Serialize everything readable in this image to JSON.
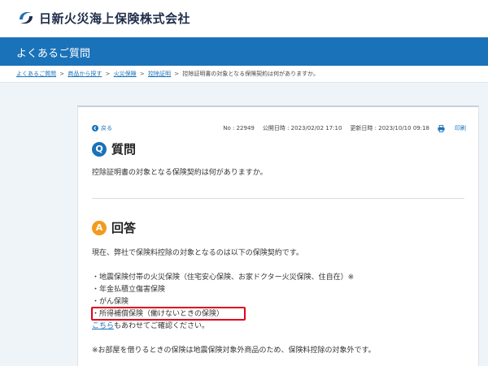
{
  "header": {
    "company_name": "日新火災海上保険株式会社",
    "logo_icon": "nisshin-logo-icon",
    "brand_color": "#1a72b9"
  },
  "title_bar": {
    "title": "よくあるご質問"
  },
  "breadcrumb": {
    "items": [
      "よくあるご質問",
      "商品から探す",
      "火災保険",
      "控除証明"
    ],
    "separator": ">",
    "current": "控除証明書の対象となる保険契約は何がありますか。"
  },
  "meta": {
    "back_label": "戻る",
    "faq_no": "No : 22949",
    "published": "公開日時 : 2023/02/02 17:10",
    "updated": "更新日時 : 2023/10/10 09:18",
    "print_label": "印刷"
  },
  "question": {
    "badge": "Q",
    "heading": "質問",
    "text": "控除証明書の対象となる保険契約は何がありますか。"
  },
  "answer": {
    "badge": "A",
    "heading": "回答",
    "accent_color": "#f39a1e",
    "intro": "現在、弊社で保険料控除の対象となるのは以下の保険契約です。",
    "items": [
      "・地震保険付帯の火災保険（住宅安心保険、お家ドクター火災保険、住自在）※",
      "・年金払積立傷害保険",
      "・がん保険",
      "・所得補償保険（働けないときの保険）"
    ],
    "link_text": "こちら",
    "link_suffix": "もあわせてご確認ください。",
    "note": "※お部屋を借りるときの保険は地震保険対象外商品のため、保険料控除の対象外です。"
  },
  "highlight_color": "#e0001b"
}
